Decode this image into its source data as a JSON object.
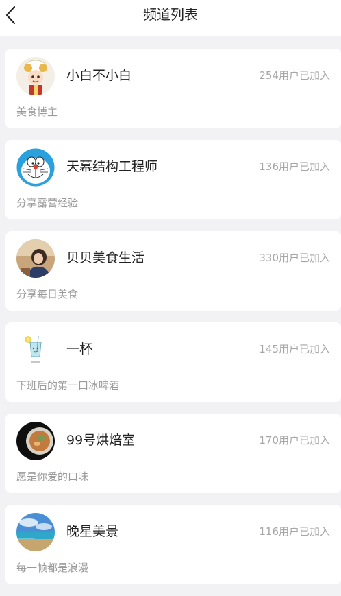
{
  "header": {
    "title": "频道列表",
    "back_icon": "chevron-left-icon"
  },
  "channels": [
    {
      "name": "小白不小白",
      "count": "254用户已加入",
      "desc": "美食博主",
      "avatar": "chef-avatar"
    },
    {
      "name": "天幕结构工程师",
      "count": "136用户已加入",
      "desc": "分享露营经验",
      "avatar": "doraemon-avatar"
    },
    {
      "name": "贝贝美食生活",
      "count": "330用户已加入",
      "desc": "分享每日美食",
      "avatar": "person-photo-avatar"
    },
    {
      "name": "一杯",
      "count": "145用户已加入",
      "desc": "下班后的第一口冰啤酒",
      "avatar": "drink-glass-avatar"
    },
    {
      "name": "99号烘焙室",
      "count": "170用户已加入",
      "desc": "愿是你爱的口味",
      "avatar": "food-bowl-avatar"
    },
    {
      "name": "晚星美景",
      "count": "116用户已加入",
      "desc": "每一帧都是浪漫",
      "avatar": "seascape-avatar"
    }
  ],
  "colors": {
    "background": "#f2f2f4",
    "card": "#ffffff",
    "title_text": "#222222",
    "secondary_text": "#9a9a9a"
  }
}
